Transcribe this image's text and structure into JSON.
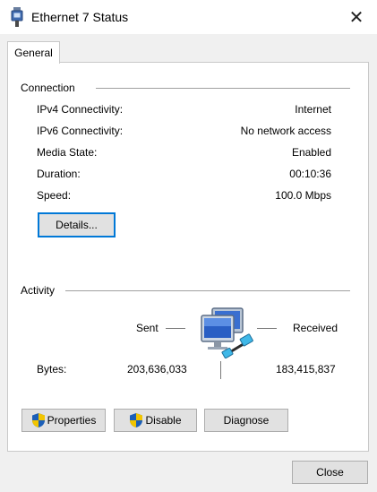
{
  "window": {
    "title": "Ethernet 7 Status",
    "close_glyph": "✕"
  },
  "tabs": [
    {
      "label": "General",
      "selected": true
    }
  ],
  "connection": {
    "heading": "Connection",
    "rows": [
      {
        "label": "IPv4 Connectivity:",
        "value": "Internet"
      },
      {
        "label": "IPv6 Connectivity:",
        "value": "No network access"
      },
      {
        "label": "Media State:",
        "value": "Enabled"
      },
      {
        "label": "Duration:",
        "value": "00:10:36"
      },
      {
        "label": "Speed:",
        "value": "100.0 Mbps"
      }
    ],
    "details_button": "Details..."
  },
  "activity": {
    "heading": "Activity",
    "sent_label": "Sent",
    "received_label": "Received",
    "bytes_label": "Bytes:",
    "bytes_sent": "203,636,033",
    "bytes_received": "183,415,837"
  },
  "actions": {
    "properties": "Properties",
    "disable": "Disable",
    "diagnose": "Diagnose"
  },
  "footer": {
    "close": "Close"
  },
  "colors": {
    "focus_border": "#0078d7",
    "shield_blue": "#1c5fb8",
    "shield_yellow": "#f2c500"
  }
}
